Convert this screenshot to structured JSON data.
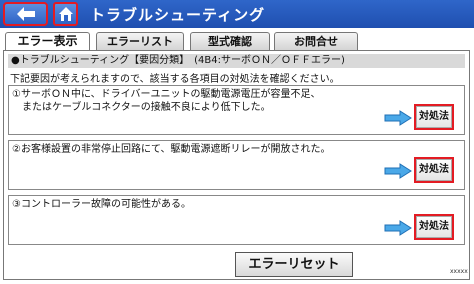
{
  "header": {
    "title": "トラブルシューティング",
    "back_icon": "back-arrow-icon",
    "home_icon": "home-icon",
    "accent_color": "#e31b23",
    "bar_color": "#2f66c9"
  },
  "tabs": [
    {
      "label": "エラー表示",
      "active": true
    },
    {
      "label": "エラーリスト",
      "active": false
    },
    {
      "label": "型式確認",
      "active": false
    },
    {
      "label": "お問合せ",
      "active": false
    }
  ],
  "section": {
    "heading": "●トラブルシューティング【要因分類】　(4B4:サーボＯＮ／ＯＦＦエラー)",
    "intro": "下記要因が考えられますので、該当する各項目の対処法を確認ください。"
  },
  "causes": [
    {
      "line1": "①サーボＯＮ中に、ドライバーユニットの駆動電源電圧が容量不足、",
      "line2": "　またはケーブルコネクターの接触不良により低下した。",
      "button": "対処法"
    },
    {
      "line1": "②お客様設置の非常停止回路にて、駆動電源遮断リレーが開放された。",
      "line2": "",
      "button": "対処法"
    },
    {
      "line1": "③コントローラー故障の可能性がある。",
      "line2": "",
      "button": "対処法"
    }
  ],
  "footer": {
    "reset_label": "エラーリセット",
    "code": "xxxxx"
  }
}
